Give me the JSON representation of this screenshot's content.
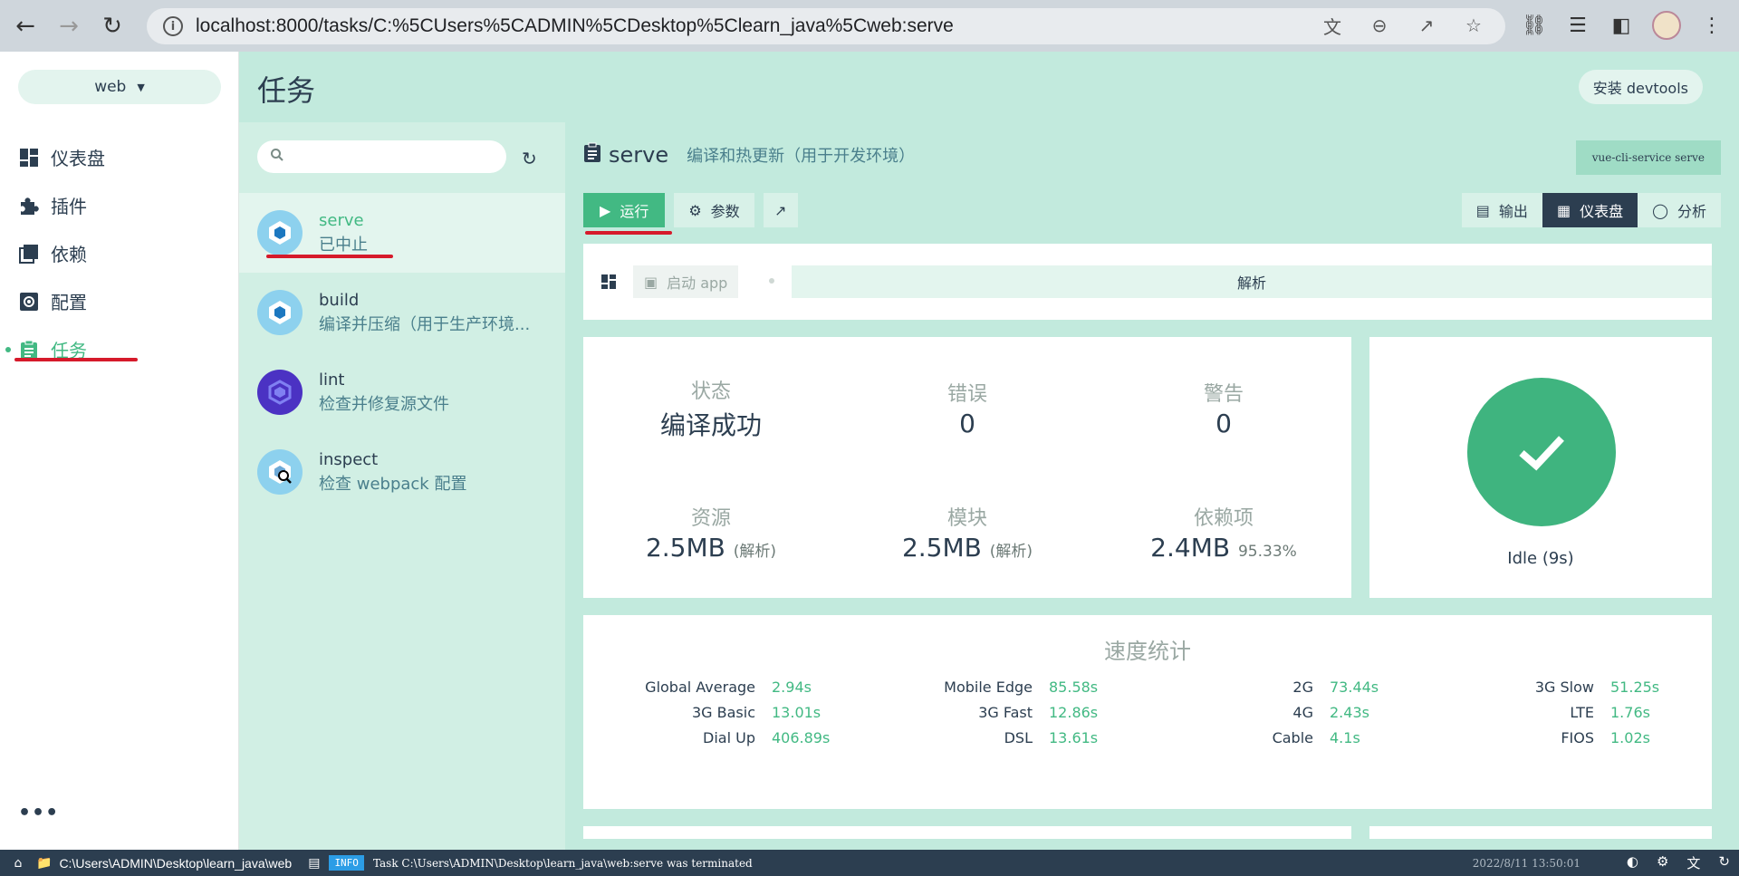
{
  "browser": {
    "url": "localhost:8000/tasks/C:%5CUsers%5CADMIN%5CDesktop%5Clearn_java%5Cweb:serve"
  },
  "sidebar": {
    "project": "web",
    "items": [
      {
        "label": "仪表盘",
        "icon": "dashboard-icon"
      },
      {
        "label": "插件",
        "icon": "puzzle-icon"
      },
      {
        "label": "依赖",
        "icon": "library-icon"
      },
      {
        "label": "配置",
        "icon": "settings-icon"
      },
      {
        "label": "任务",
        "icon": "clipboard-icon"
      }
    ],
    "active": "任务",
    "more": "•••"
  },
  "header": {
    "title": "任务",
    "devtools_button": "安装 devtools"
  },
  "tasks": [
    {
      "name": "serve",
      "desc": "已中止"
    },
    {
      "name": "build",
      "desc": "编译并压缩（用于生产环境..."
    },
    {
      "name": "lint",
      "desc": "检查并修复源文件"
    },
    {
      "name": "inspect",
      "desc": "检查 webpack 配置"
    }
  ],
  "task_detail": {
    "name": "serve",
    "desc": "编译和热更新（用于开发环境）",
    "command": "vue-cli-service serve",
    "run_label": "运行",
    "params_label": "参数",
    "view_tabs": [
      "输出",
      "仪表盘",
      "分析"
    ],
    "active_tab": "仪表盘"
  },
  "dashboard": {
    "start_app": "启动 app",
    "analyze": "解析",
    "stats": {
      "status_label": "状态",
      "status_value": "编译成功",
      "errors_label": "错误",
      "errors_value": "0",
      "warnings_label": "警告",
      "warnings_value": "0",
      "assets_label": "资源",
      "assets_value": "2.5MB",
      "assets_sub": "(解析)",
      "modules_label": "模块",
      "modules_value": "2.5MB",
      "modules_sub": "(解析)",
      "deps_label": "依赖项",
      "deps_value": "2.4MB",
      "deps_sub": "95.33%"
    },
    "status_text": "Idle (9s)",
    "speed_title": "速度统计",
    "speed": [
      [
        {
          "k": "Global Average",
          "v": "2.94s"
        },
        {
          "k": "Mobile Edge",
          "v": "85.58s"
        },
        {
          "k": "2G",
          "v": "73.44s"
        },
        {
          "k": "3G Slow",
          "v": "51.25s"
        }
      ],
      [
        {
          "k": "3G Basic",
          "v": "13.01s"
        },
        {
          "k": "3G Fast",
          "v": "12.86s"
        },
        {
          "k": "4G",
          "v": "2.43s"
        },
        {
          "k": "LTE",
          "v": "1.76s"
        }
      ],
      [
        {
          "k": "Dial Up",
          "v": "406.89s"
        },
        {
          "k": "DSL",
          "v": "13.61s"
        },
        {
          "k": "Cable",
          "v": "4.1s"
        },
        {
          "k": "FIOS",
          "v": "1.02s"
        }
      ]
    ]
  },
  "statusbar": {
    "path": "C:\\Users\\ADMIN\\Desktop\\learn_java\\web",
    "log_level": "INFO",
    "message": "Task C:\\Users\\ADMIN\\Desktop\\learn_java\\web:serve was terminated",
    "time": "2022/8/11 13:50:01"
  },
  "colors": {
    "accent": "#42b983",
    "header_bg": "#c2eadd",
    "dark": "#2c3e50",
    "annotation": "#d61a2b"
  }
}
